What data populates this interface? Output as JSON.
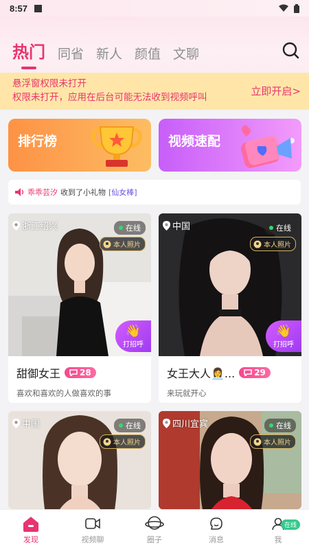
{
  "status_bar": {
    "time": "8:57"
  },
  "tabs": [
    {
      "label": "热门",
      "active": true
    },
    {
      "label": "同省",
      "active": false
    },
    {
      "label": "新人",
      "active": false
    },
    {
      "label": "颜值",
      "active": false
    },
    {
      "label": "文聊",
      "active": false
    }
  ],
  "notice": {
    "line1": "悬浮窗权限未打开",
    "line2": "权限未打开，应用在后台可能无法收到视频呼叫",
    "action": "立即开启>"
  },
  "features": {
    "rank": "排行榜",
    "video_match": "视频速配"
  },
  "gift_bar": {
    "name": "乖乖芸汐",
    "text": "收到了小礼物",
    "gift": "[仙女棒]"
  },
  "cards": [
    {
      "location": "浙江绍兴",
      "online": "在线",
      "verified": "本人照片",
      "wave": "打招呼",
      "name": "甜御女王",
      "level": "28",
      "signature": "喜欢和喜欢的人做喜欢的事"
    },
    {
      "location": "中国",
      "online": "在线",
      "verified": "本人照片",
      "wave": "打招呼",
      "name": "女王大人👩‍💼...",
      "level": "29",
      "signature": "来玩就开心"
    },
    {
      "location": "中国",
      "online": "在线",
      "verified": "本人照片"
    },
    {
      "location": "四川宜宾",
      "online": "在线",
      "verified": "本人照片"
    }
  ],
  "bottom_nav": [
    {
      "label": "发现",
      "active": true
    },
    {
      "label": "视频聊",
      "active": false
    },
    {
      "label": "圈子",
      "active": false
    },
    {
      "label": "消息",
      "active": false
    },
    {
      "label": "我",
      "active": false,
      "badge": "在线"
    }
  ],
  "colors": {
    "accent": "#e8356f",
    "notice_bg": "#ffe6a8"
  }
}
